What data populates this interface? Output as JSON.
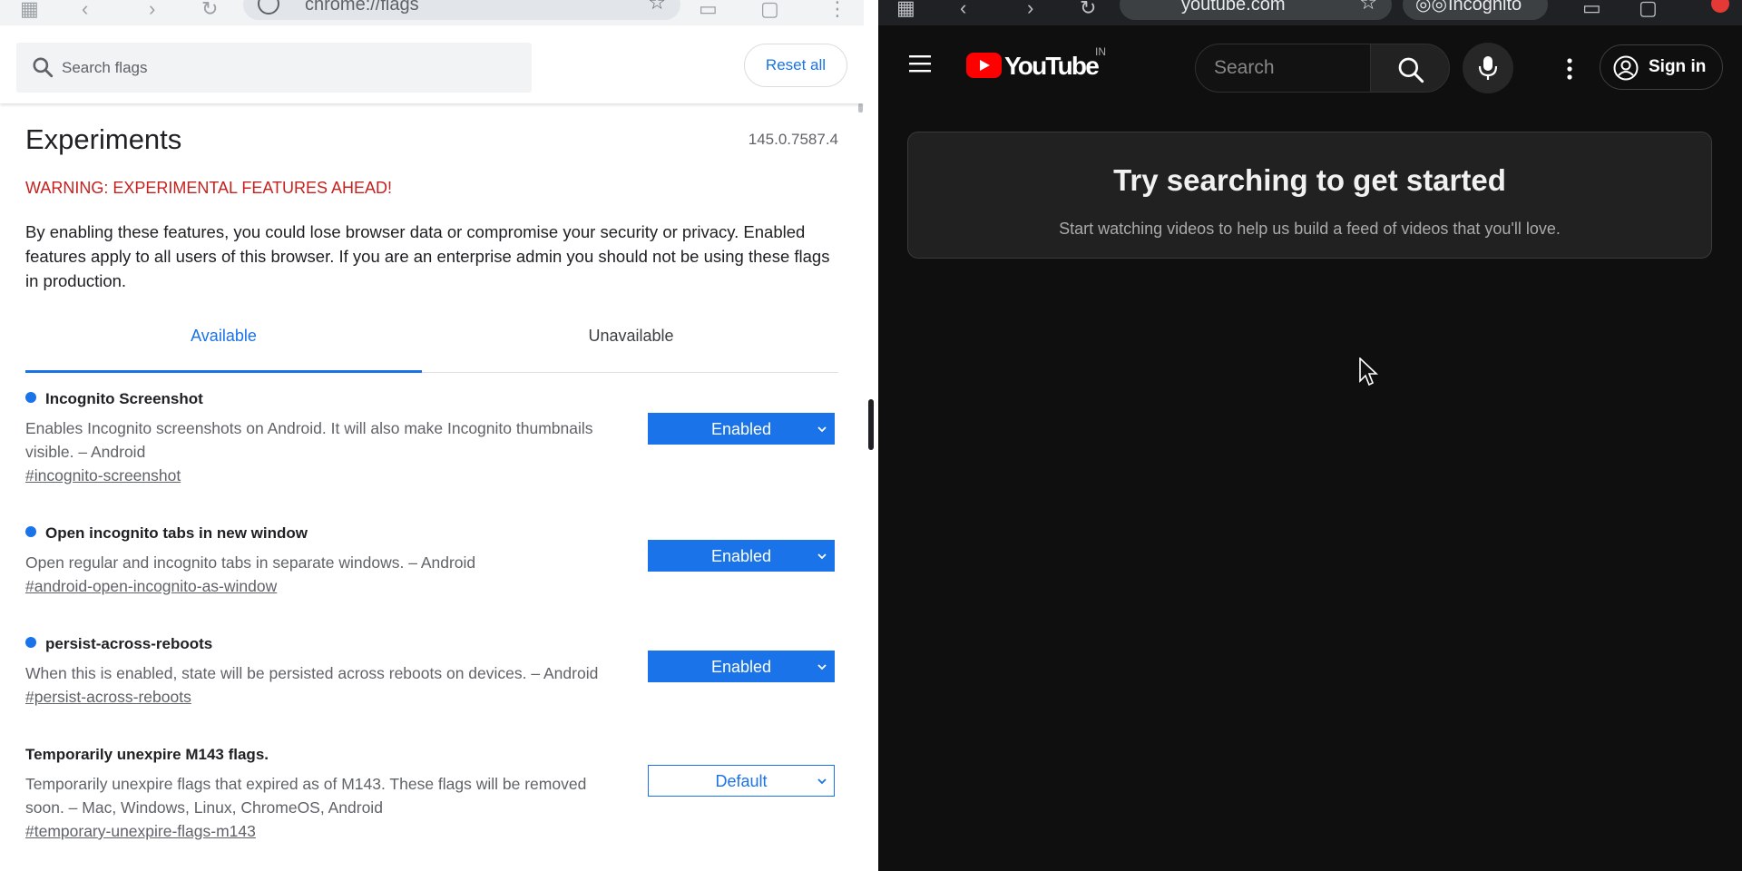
{
  "left_window": {
    "address": "chrome://flags",
    "search": {
      "placeholder": "Search flags"
    },
    "reset_label": "Reset all",
    "title": "Experiments",
    "version": "145.0.7587.4",
    "warning": "WARNING: EXPERIMENTAL FEATURES AHEAD!",
    "description": "By enabling these features, you could lose browser data or compromise your security or privacy. Enabled features apply to all users of this browser. If you are an enterprise admin you should not be using these flags in production.",
    "tabs": [
      {
        "label": "Available",
        "active": true
      },
      {
        "label": "Unavailable",
        "active": false
      }
    ],
    "experiments": [
      {
        "name": "Incognito Screenshot",
        "modified": true,
        "description": "Enables Incognito screenshots on Android. It will also make Incognito thumbnails visible. – Android",
        "link": "#incognito-screenshot",
        "value": "Enabled"
      },
      {
        "name": "Open incognito tabs in new window",
        "modified": true,
        "description": "Open regular and incognito tabs in separate windows. – Android",
        "link": "#android-open-incognito-as-window",
        "value": "Enabled"
      },
      {
        "name": "persist-across-reboots",
        "modified": true,
        "description": "When this is enabled, state will be persisted across reboots on devices. – Android",
        "link": "#persist-across-reboots",
        "value": "Enabled"
      },
      {
        "name": "Temporarily unexpire M143 flags.",
        "modified": false,
        "description": "Temporarily unexpire flags that expired as of M143. These flags will be removed soon. – Mac, Windows, Linux, ChromeOS, Android",
        "link": "#temporary-unexpire-flags-m143",
        "value": "Default"
      }
    ],
    "colors": {
      "accent": "#1a73e8",
      "warning": "#c5221f"
    }
  },
  "right_window": {
    "address": "youtube.com",
    "incognito_label": "Incognito",
    "logo_text": "YouTube",
    "country_code": "IN",
    "search": {
      "placeholder": "Search"
    },
    "sign_in_label": "Sign in",
    "empty_title": "Try searching to get started",
    "empty_subtitle": "Start watching videos to help us build a feed of videos that you'll love.",
    "colors": {
      "background": "#0f0f0f",
      "brand_red": "#ff0000"
    }
  },
  "icons": {
    "left": [
      "apps-icon",
      "back-icon",
      "forward-icon",
      "reload-icon",
      "site-info-icon",
      "bookmark-star-icon",
      "search-icon",
      "chevron-down-icon"
    ],
    "right": [
      "apps-icon",
      "back-icon",
      "forward-icon",
      "reload-icon",
      "bookmark-star-icon",
      "incognito-icon",
      "hamburger-menu-icon",
      "youtube-play-icon",
      "search-icon",
      "microphone-icon",
      "more-vert-icon",
      "account-circle-icon",
      "mouse-cursor-icon"
    ]
  }
}
